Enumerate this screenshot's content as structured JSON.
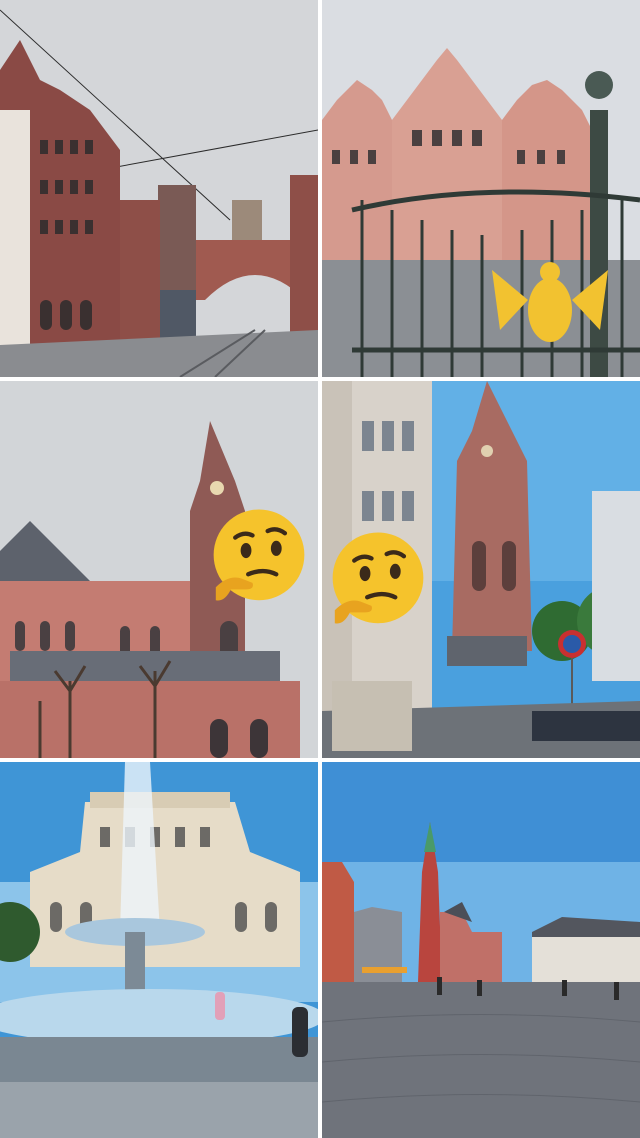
{
  "collage": {
    "photos": [
      {
        "subject": "roemer-bridge-street"
      },
      {
        "subject": "roemer-facade-gate"
      },
      {
        "subject": "cathedral-side-view"
      },
      {
        "subject": "cathedral-street-view"
      },
      {
        "subject": "alte-oper-fountain"
      },
      {
        "subject": "roemerberg-square"
      }
    ],
    "stickers": [
      "thinking-face-emoji",
      "thinking-face-emoji"
    ],
    "colors": {
      "sky_grey": "#cfd2d6",
      "sky_blue": "#4aa0de",
      "sandstone": "#b06a62",
      "gold": "#f2c230",
      "cobble": "#6d7078"
    }
  }
}
